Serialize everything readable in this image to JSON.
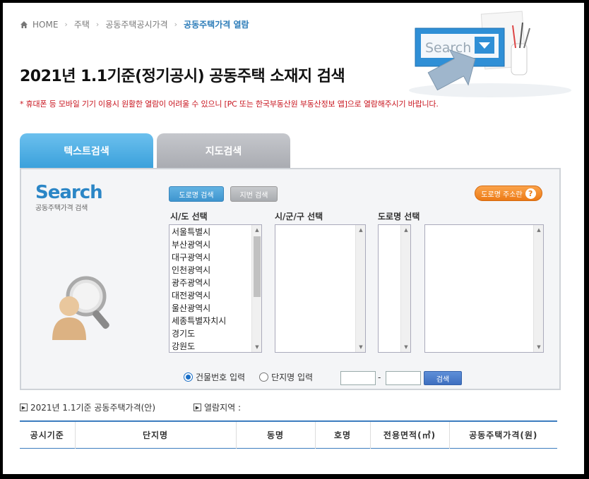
{
  "breadcrumb": {
    "home": "HOME",
    "items": [
      "주택",
      "공동주택공시가격",
      "공동주택가격 열람"
    ]
  },
  "hero": {
    "search_word": "Search"
  },
  "page_title": "2021년 1.1기준(정기공시) 공동주택 소재지 검색",
  "notice": "* 휴대폰 등 모바일 기기 이용시 원활한 열람이 어려울 수 있으니 [PC 또는 한국부동산원 부동산정보 앱]으로 열람해주시기 바랍니다.",
  "tabs": {
    "text_search": "텍스트검색",
    "map_search": "지도검색"
  },
  "panel": {
    "logo_big": "Search",
    "logo_small": "공동주택가격 검색",
    "road_search_button": "도로명 검색",
    "lot_search_button": "지번 검색",
    "road_guide_button": "도로명 주소란",
    "road_guide_icon": "?",
    "labels": {
      "sido": "시/도 선택",
      "sigungu": "시/군/구 선택",
      "road": "도로명 선택"
    },
    "sido_options": [
      "서울특별시",
      "부산광역시",
      "대구광역시",
      "인천광역시",
      "광주광역시",
      "대전광역시",
      "울산광역시",
      "세종특별자치시",
      "경기도",
      "강원도"
    ],
    "radio_building": "건물번호 입력",
    "radio_complex": "단지명 입력",
    "dash": "-",
    "search_button": "검색"
  },
  "info": {
    "notice_label": "2021년 1.1기준 공동주택가격(안)",
    "region_label": "열람지역 :"
  },
  "table": {
    "headers": [
      "공시기준",
      "단지명",
      "동명",
      "호명",
      "전용면적(㎡)",
      "공동주택가격(원)"
    ]
  },
  "colors": {
    "accent_blue": "#3aa0db",
    "notice_red": "#c8141e",
    "orange": "#ec7a16"
  }
}
